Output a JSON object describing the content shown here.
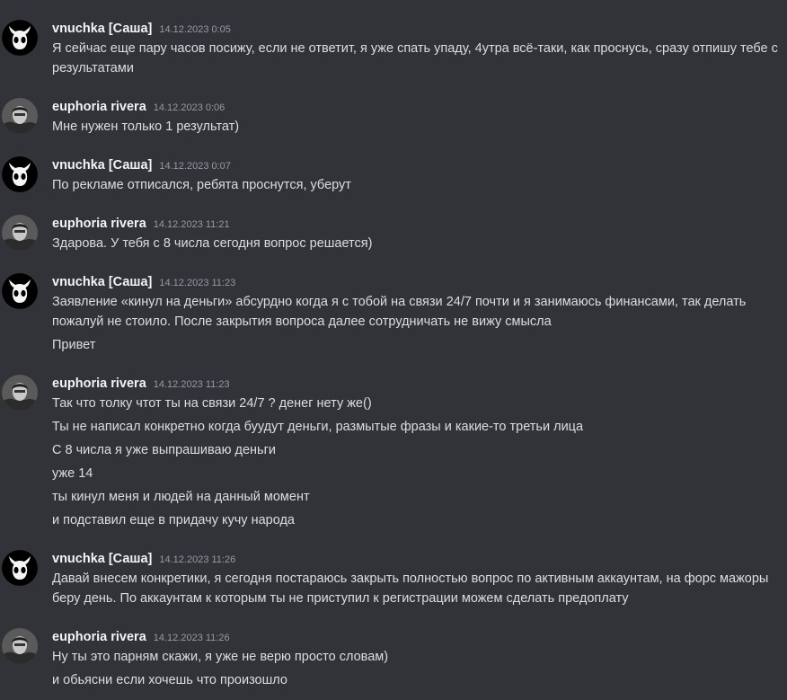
{
  "messages": [
    {
      "author": "vnuchka [Саша]",
      "avatar": "hollow-knight-icon",
      "time": "14.12.2023 0:05",
      "lines": [
        "Я сейчас еще пару часов посижу, если не ответит, я уже спать упаду, 4утра всё-таки, как проснусь, сразу отпишу тебе с результатами"
      ]
    },
    {
      "author": "euphoria rivera",
      "avatar": "user-photo-avatar",
      "time": "14.12.2023 0:06",
      "lines": [
        "Мне нужен только 1 результат)"
      ]
    },
    {
      "author": "vnuchka [Саша]",
      "avatar": "hollow-knight-icon",
      "time": "14.12.2023 0:07",
      "lines": [
        "По рекламе отписался, ребята проснутся, уберут"
      ]
    },
    {
      "author": "euphoria rivera",
      "avatar": "user-photo-avatar",
      "time": "14.12.2023 11:21",
      "lines": [
        "Здарова. У тебя с 8  числа сегодня вопрос решается)"
      ]
    },
    {
      "author": "vnuchka [Саша]",
      "avatar": "hollow-knight-icon",
      "time": "14.12.2023 11:23",
      "lines": [
        "Заявление «кинул на деньги» абсурдно когда я с тобой на связи 24/7 почти и я занимаюсь финансами, так делать пожалуй не стоило. После закрытия вопроса далее сотрудничать не вижу смысла",
        "Привет"
      ]
    },
    {
      "author": "euphoria rivera",
      "avatar": "user-photo-avatar",
      "time": "14.12.2023 11:23",
      "lines": [
        "Так что толку  чтот ты на связи 24/7 ? денег нету же()",
        "Ты не написал конкретно  когда буудут деньги, размытые фразы и какие-то третьи лица",
        "С 8 числа я уже выпрашиваю деньги",
        "уже 14",
        "ты кинул меня и  людей  на данный момент",
        "и подставил еще в придачу кучу народа"
      ]
    },
    {
      "author": "vnuchka [Саша]",
      "avatar": "hollow-knight-icon",
      "time": "14.12.2023 11:26",
      "lines": [
        "Давай внесем конкретики, я сегодня постараюсь закрыть полностью вопрос по активным аккаунтам, на форс мажоры беру день. По аккаунтам к которым ты не приступил к регистрации можем сделать предоплату"
      ]
    },
    {
      "author": "euphoria rivera",
      "avatar": "user-photo-avatar",
      "time": "14.12.2023 11:26",
      "lines": [
        "Ну ты это парням скажи, я уже не верю просто словам)",
        "и обьясни если хочешь что  произошло"
      ]
    }
  ]
}
